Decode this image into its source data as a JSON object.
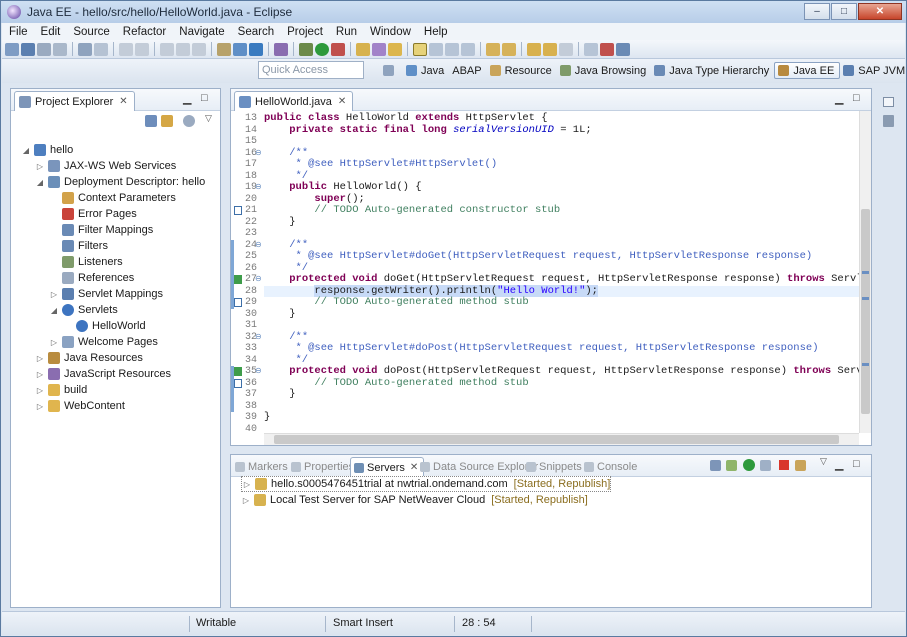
{
  "window": {
    "title": "Java EE - hello/src/hello/HelloWorld.java - Eclipse",
    "buttons": [
      "–",
      "□",
      "✕"
    ]
  },
  "menu": [
    "File",
    "Edit",
    "Source",
    "Refactor",
    "Navigate",
    "Search",
    "Project",
    "Run",
    "Window",
    "Help"
  ],
  "quick_access": {
    "placeholder": "Quick Access"
  },
  "perspectives": [
    "Java",
    "ABAP",
    "Resource",
    "Java Browsing",
    "Java Type Hierarchy",
    "Java EE",
    "SAP JVM Profiler"
  ],
  "active_perspective": "Java EE",
  "project_explorer": {
    "tab_label": "Project Explorer",
    "items": [
      {
        "label": "hello",
        "level": 0,
        "twisty": "open",
        "icon": "project-icon"
      },
      {
        "label": "JAX-WS Web Services",
        "level": 1,
        "twisty": "closed",
        "icon": "webservice-icon"
      },
      {
        "label": "Deployment Descriptor: hello",
        "level": 1,
        "twisty": "open",
        "icon": "descriptor-icon"
      },
      {
        "label": "Context Parameters",
        "level": 2,
        "twisty": "none",
        "icon": "context-icon"
      },
      {
        "label": "Error Pages",
        "level": 2,
        "twisty": "none",
        "icon": "error-icon"
      },
      {
        "label": "Filter Mappings",
        "level": 2,
        "twisty": "none",
        "icon": "filter-icon"
      },
      {
        "label": "Filters",
        "level": 2,
        "twisty": "none",
        "icon": "filter-icon"
      },
      {
        "label": "Listeners",
        "level": 2,
        "twisty": "none",
        "icon": "listener-icon"
      },
      {
        "label": "References",
        "level": 2,
        "twisty": "none",
        "icon": "reference-icon"
      },
      {
        "label": "Servlet Mappings",
        "level": 2,
        "twisty": "closed",
        "icon": "mapping-icon"
      },
      {
        "label": "Servlets",
        "level": 2,
        "twisty": "open",
        "icon": "servlet-icon"
      },
      {
        "label": "HelloWorld",
        "level": 3,
        "twisty": "none",
        "icon": "servlet-icon"
      },
      {
        "label": "Welcome Pages",
        "level": 2,
        "twisty": "closed",
        "icon": "welcome-icon"
      },
      {
        "label": "Java Resources",
        "level": 1,
        "twisty": "closed",
        "icon": "java-resources-icon"
      },
      {
        "label": "JavaScript Resources",
        "level": 1,
        "twisty": "closed",
        "icon": "javascript-icon"
      },
      {
        "label": "build",
        "level": 1,
        "twisty": "closed",
        "icon": "folder-icon"
      },
      {
        "label": "WebContent",
        "level": 1,
        "twisty": "closed",
        "icon": "folder-icon"
      }
    ]
  },
  "editor": {
    "tab_label": "HelloWorld.java",
    "lines": [
      {
        "n": "13",
        "html": "<span class=\"kw\">public class</span> HelloWorld <span class=\"kw\">extends</span> HttpServlet {"
      },
      {
        "n": "14",
        "html": "    <span class=\"kw\">private static final long</span> <span class=\"it\">serialVersionUID</span> = 1L;"
      },
      {
        "n": "15",
        "html": ""
      },
      {
        "n": "16",
        "fold": "⊖",
        "html": "    <span class=\"cm\">/**</span>"
      },
      {
        "n": "17",
        "html": "<span class=\"cm\">     * @see HttpServlet#HttpServlet()</span>"
      },
      {
        "n": "18",
        "html": "<span class=\"cm\">     */</span>"
      },
      {
        "n": "19",
        "fold": "⊖",
        "html": "    <span class=\"kw\">public</span> HelloWorld() {"
      },
      {
        "n": "20",
        "html": "        <span class=\"kw\">super</span>();"
      },
      {
        "n": "21",
        "marker": "task",
        "html": "        <span class=\"cmt\">// TODO Auto-generated constructor stub</span>"
      },
      {
        "n": "22",
        "html": "    }"
      },
      {
        "n": "23",
        "html": ""
      },
      {
        "n": "24",
        "fold": "⊖",
        "html": "    <span class=\"cm\">/**</span>"
      },
      {
        "n": "25",
        "html": "<span class=\"cm\">     * @see HttpServlet#doGet(HttpServletRequest request, HttpServletResponse response)</span>"
      },
      {
        "n": "26",
        "html": "<span class=\"cm\">     */</span>"
      },
      {
        "n": "27",
        "fold": "⊖",
        "marker": "override",
        "html": "    <span class=\"kw\">protected void</span> doGet(HttpServletRequest request, HttpServletResponse response) <span class=\"kw\">throws</span> ServletException, I"
      },
      {
        "n": "28",
        "current": true,
        "html": "        <span class=\"sel\">response.getWriter().println(<span class=\"str\">\"Hello World!\"</span>);</span>"
      },
      {
        "n": "29",
        "marker": "task",
        "html": "        <span class=\"cmt\">// TODO Auto-generated method stub</span>"
      },
      {
        "n": "30",
        "html": "    }"
      },
      {
        "n": "31",
        "html": ""
      },
      {
        "n": "32",
        "fold": "⊖",
        "html": "    <span class=\"cm\">/**</span>"
      },
      {
        "n": "33",
        "html": "<span class=\"cm\">     * @see HttpServlet#doPost(HttpServletRequest request, HttpServletResponse response)</span>"
      },
      {
        "n": "34",
        "html": "<span class=\"cm\">     */</span>"
      },
      {
        "n": "35",
        "fold": "⊖",
        "marker": "override",
        "html": "    <span class=\"kw\">protected void</span> doPost(HttpServletRequest request, HttpServletResponse response) <span class=\"kw\">throws</span> ServletException,"
      },
      {
        "n": "36",
        "marker": "task",
        "html": "        <span class=\"cmt\">// TODO Auto-generated method stub</span>"
      },
      {
        "n": "37",
        "html": "    }"
      },
      {
        "n": "38",
        "html": ""
      },
      {
        "n": "39",
        "html": "}"
      },
      {
        "n": "40",
        "html": ""
      }
    ]
  },
  "bottom_panel": {
    "tabs": [
      "Markers",
      "Properties",
      "Servers",
      "Data Source Explorer",
      "Snippets",
      "Console"
    ],
    "active_tab": "Servers",
    "servers": [
      {
        "name": "hello.s0005476451trial at nwtrial.ondemand.com",
        "status": "[Started, Republish]"
      },
      {
        "name": "Local Test Server for SAP NetWeaver Cloud",
        "status": "[Started, Republish]"
      }
    ]
  },
  "status_bar": {
    "mode": "Writable",
    "insert": "Smart Insert",
    "position": "28 : 54"
  },
  "colors": {
    "keyword": "#7f0055",
    "javadoc": "#3f5fbf",
    "comment": "#3f7f5f",
    "string": "#2a00ff",
    "field": "#0000c0",
    "selection": "#c7daf7",
    "current_line": "#e8f2fe"
  }
}
